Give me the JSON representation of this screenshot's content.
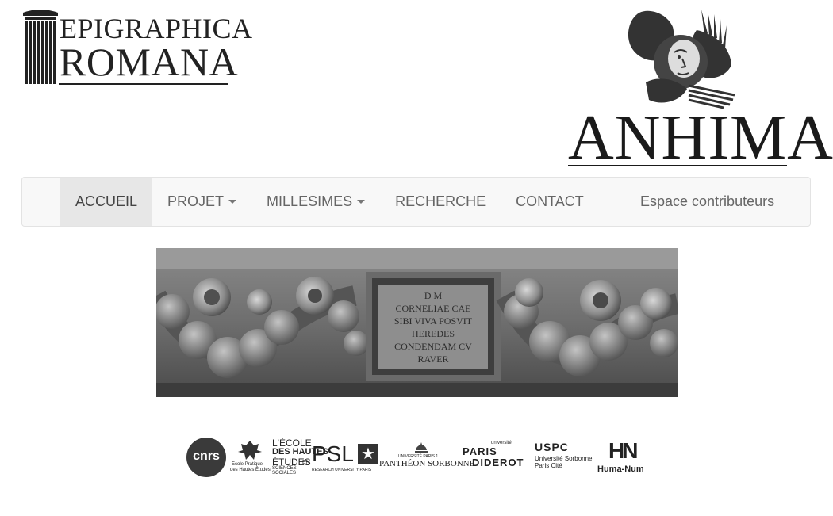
{
  "header": {
    "logo_left": {
      "line1": "EPIGRAPHICA",
      "line2": "ROMANA"
    },
    "logo_right": {
      "word": "ANHIMA"
    }
  },
  "nav": {
    "items": [
      {
        "label": "ACCUEIL",
        "active": true,
        "dropdown": false
      },
      {
        "label": "PROJET",
        "active": false,
        "dropdown": true
      },
      {
        "label": "MILLESIMES",
        "active": false,
        "dropdown": true
      },
      {
        "label": "RECHERCHE",
        "active": false,
        "dropdown": false
      },
      {
        "label": "CONTACT",
        "active": false,
        "dropdown": false
      }
    ],
    "contrib_label": "Espace contributeurs"
  },
  "banner": {
    "inscription": [
      "D M",
      "CORNELIAE CAE",
      "SIBI VIVA POSVIT",
      "HEREDES",
      "CONDENDAM CV",
      "RAVER"
    ]
  },
  "partners": {
    "cnrs": "cnrs",
    "ephe": [
      "École Pratique",
      "des Hautes Études"
    ],
    "ehess": [
      "L'ÉCOLE",
      "DES HAUTES",
      "ÉTUDES",
      "EN",
      "SCIENCES",
      "SOCIALES"
    ],
    "psl": [
      "PSL",
      "RESEARCH UNIVERSITY PARIS"
    ],
    "pantheon": [
      "UNIVERSITÉ PARIS 1",
      "PANTHÉON SORBONNE"
    ],
    "diderot": [
      "université",
      "PARIS",
      "DIDEROT"
    ],
    "uspc": [
      "USPC",
      "Université Sorbonne",
      "Paris Cité"
    ],
    "humanum": [
      "HN",
      "Huma-Num"
    ]
  }
}
